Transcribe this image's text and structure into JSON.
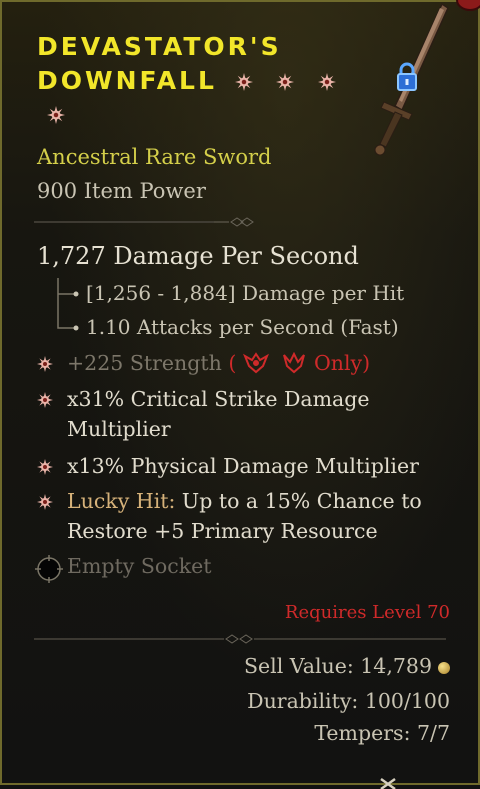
{
  "item": {
    "name_line1": "DEVASTATOR'S",
    "name_line2": "DOWNFALL",
    "type": "Ancestral Rare Sword",
    "item_power": "900 Item Power",
    "dps": "1,727 Damage Per Second",
    "damage_per_hit": "[1,256 - 1,884] Damage per Hit",
    "attacks_per_second": "1.10 Attacks per Second (Fast)",
    "affixes": [
      {
        "text": "+225 Strength",
        "note_open": "(",
        "note_only": "Only)",
        "inactive": true
      },
      {
        "text": "x31% Critical Strike Damage",
        "text2": "Multiplier"
      },
      {
        "text": "x13% Physical Damage Multiplier"
      },
      {
        "label": "Lucky Hit:",
        "text": " Up to a 15% Chance to",
        "text2": "Restore +5 Primary Resource"
      }
    ],
    "socket": "Empty Socket",
    "requires": "Requires Level 70",
    "sell_value_label": "Sell Value: 14,789",
    "durability": "Durability: 100/100",
    "tempers": "Tempers: 7/7"
  },
  "icons": [
    "star-icon",
    "lock-icon",
    "sword-icon",
    "class-icon",
    "socket-icon",
    "coin-icon"
  ],
  "colors": {
    "title": "#f2e62a",
    "type": "#d4cf4a",
    "requirement": "#cf2a2a",
    "border": "#6f6a2c"
  }
}
